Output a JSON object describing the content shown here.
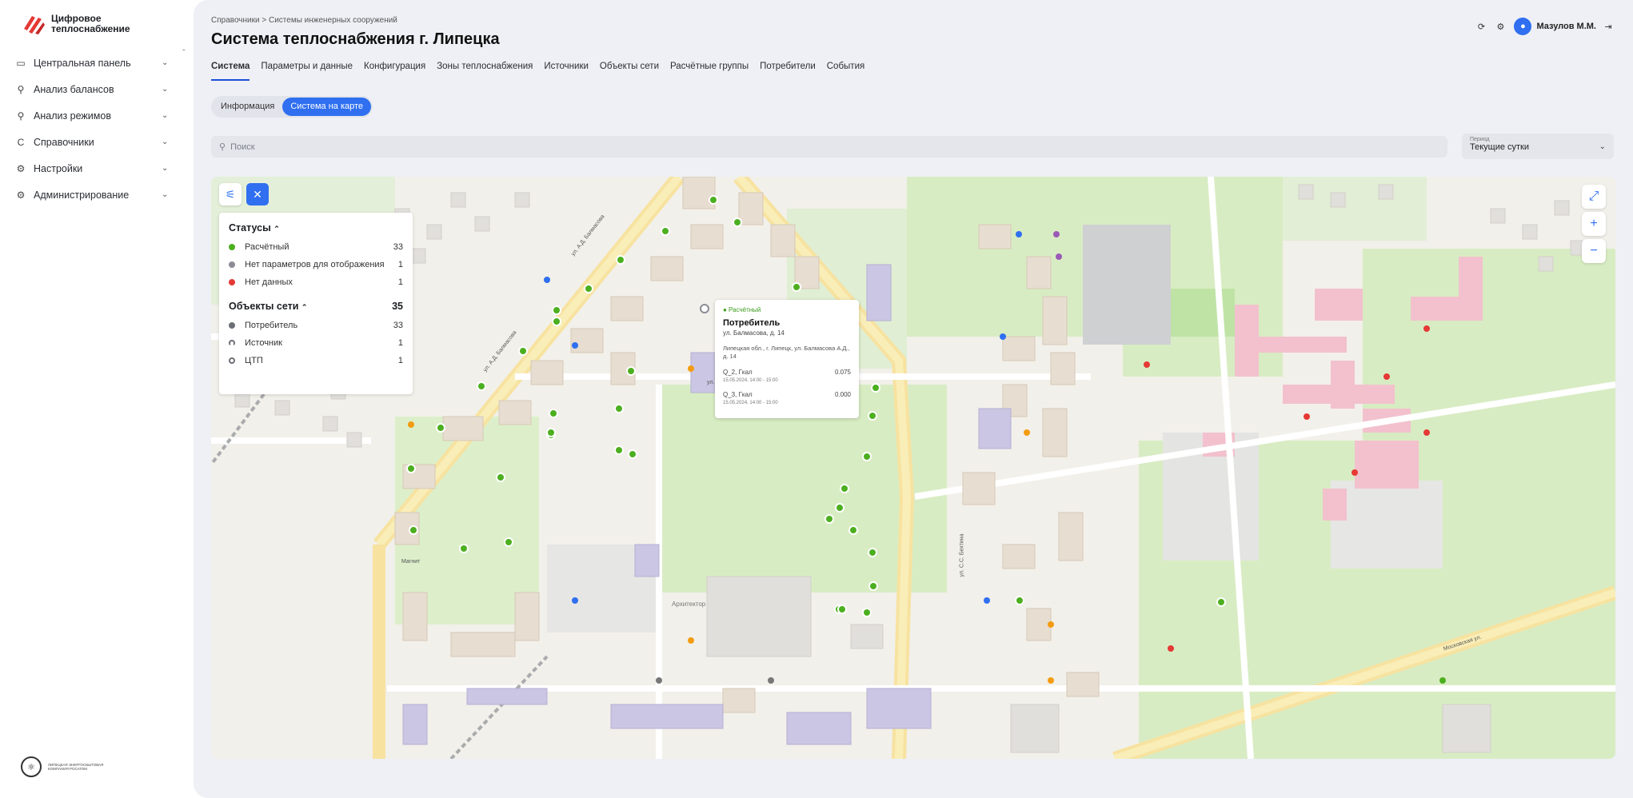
{
  "app": {
    "logo_line1": "Цифровое",
    "logo_line2": "теплоснабжение",
    "footer_logo_text": "ЛИПЕЦКАЯ ЭНЕРГОСБЫТОВАЯ КОМПАНИЯ РОСАТОМ"
  },
  "sidebar": {
    "items": [
      {
        "label": "Центральная панель",
        "icon": "dashboard-icon"
      },
      {
        "label": "Анализ балансов",
        "icon": "balance-icon"
      },
      {
        "label": "Анализ режимов",
        "icon": "modes-icon"
      },
      {
        "label": "Справочники",
        "icon": "directory-icon"
      },
      {
        "label": "Настройки",
        "icon": "settings-icon"
      },
      {
        "label": "Администрирование",
        "icon": "admin-icon"
      }
    ]
  },
  "header": {
    "breadcrumb": "Справочники  >  Системы инженерных сооружений",
    "title": "Система теплоснабжения г. Липецка",
    "user": "Мазулов М.М."
  },
  "tabs": [
    "Система",
    "Параметры и данные",
    "Конфигурация",
    "Зоны теплоснабжения",
    "Источники",
    "Объекты сети",
    "Расчётные группы",
    "Потребители",
    "События"
  ],
  "segment": {
    "info": "Информация",
    "map": "Система на карте"
  },
  "search": {
    "placeholder": "Поиск"
  },
  "period": {
    "label": "Период",
    "value": "Текущие сутки"
  },
  "legend": {
    "statuses_title": "Статусы",
    "statuses": [
      {
        "label": "Расчётный",
        "count": "33",
        "color": "#4caf1f"
      },
      {
        "label": "Нет параметров для отображения",
        "count": "1",
        "color": "#8a8d94"
      },
      {
        "label": "Нет данных",
        "count": "1",
        "color": "#e53935"
      }
    ],
    "objects_title": "Объекты сети",
    "objects_count": "35",
    "objects": [
      {
        "label": "Потребитель",
        "count": "33"
      },
      {
        "label": "Источник",
        "count": "1"
      },
      {
        "label": "ЦТП",
        "count": "1"
      }
    ]
  },
  "popup": {
    "status": "● Расчётный",
    "title": "Потребитель",
    "address": "ул. Балмасова, д. 14",
    "full_address": "Липецкая обл., г. Липецк, ул. Балмасова А.Д., д. 14",
    "row1_label": "Q_2, Гкал",
    "row1_value": "0.075",
    "row1_time": "15.05.2024, 14:00 - 15:00",
    "row2_label": "Q_3, Гкал",
    "row2_value": "0.000",
    "row2_time": "15.05.2024, 14:00 - 15:00"
  },
  "map_labels": {
    "street1": "ул. А.Д. Балмасова",
    "street2": "ул. И.Г. Стаханова",
    "street3": "Московская ул.",
    "street4": "ул. С.С. Бехтина",
    "place1": "Архитектор",
    "place2": "Магнит"
  }
}
